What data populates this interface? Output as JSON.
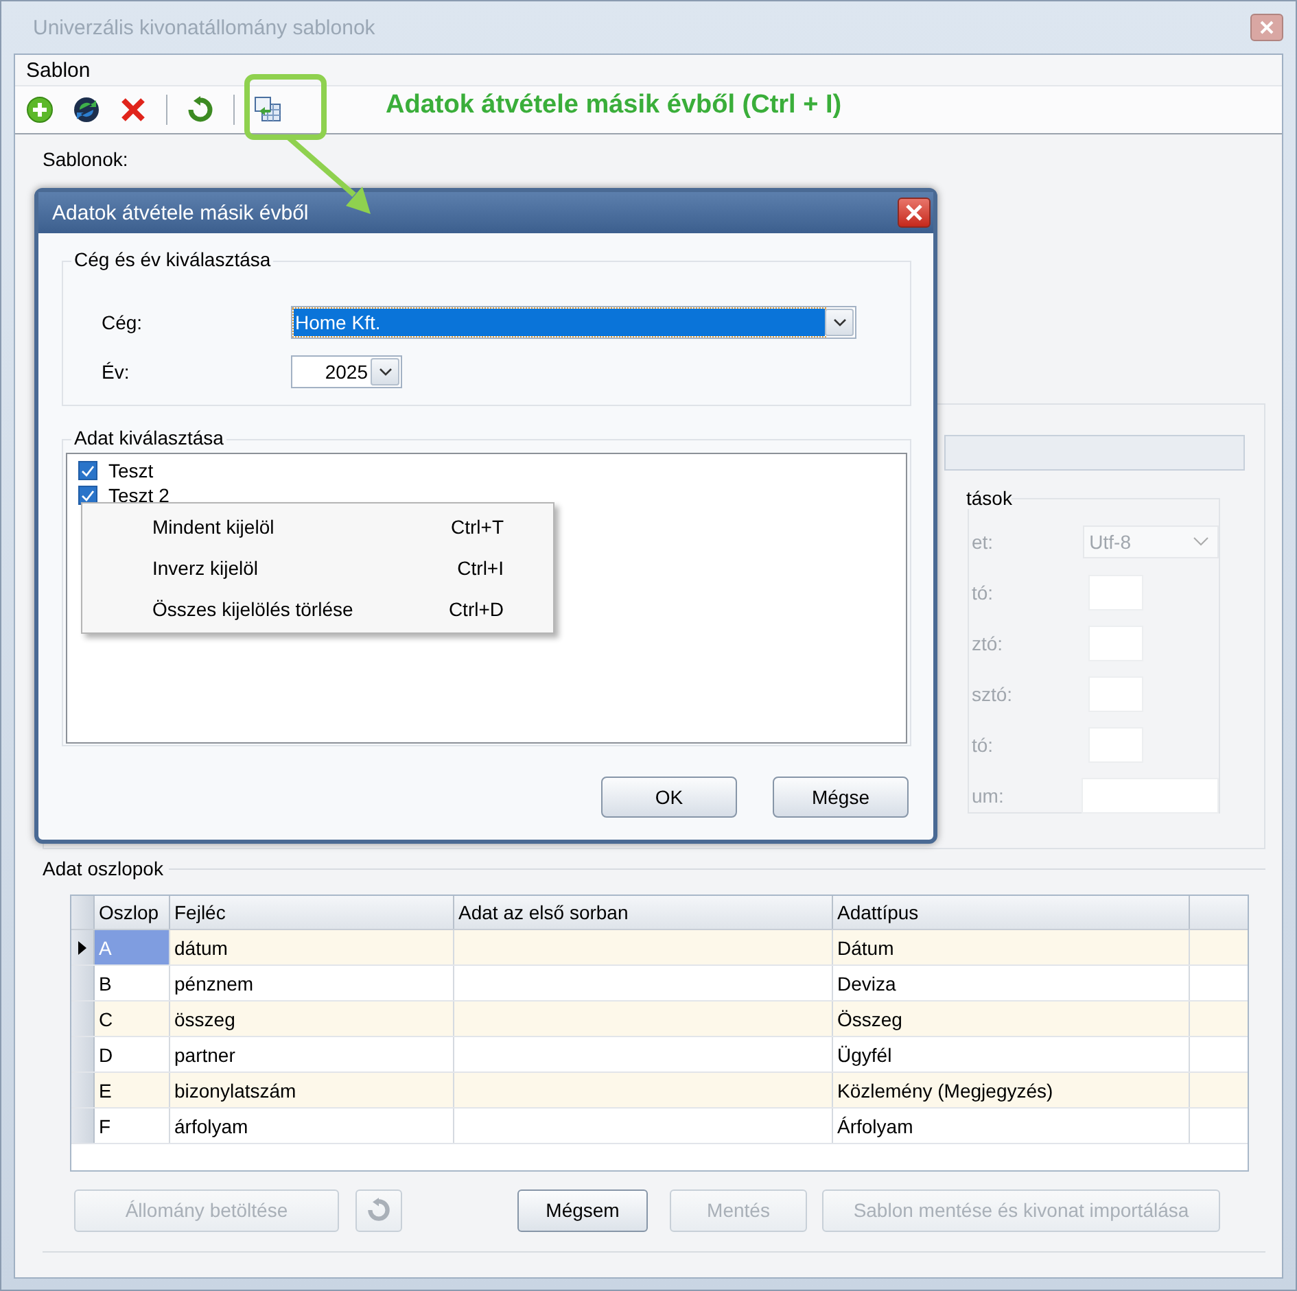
{
  "window": {
    "title": "Univerzális kivonatállomány sablonok",
    "active": false
  },
  "menu": [
    {
      "label": "Sablon"
    }
  ],
  "toolbar": [
    {
      "kind": "add"
    },
    {
      "kind": "sync"
    },
    {
      "kind": "delete"
    },
    {
      "kind": "separator"
    },
    {
      "kind": "refresh"
    },
    {
      "kind": "separator"
    },
    {
      "kind": "import"
    }
  ],
  "annotation": {
    "text": "Adatok átvétele másik évből (Ctrl + I)"
  },
  "templates_label": "Sablonok:",
  "settings_panel": {
    "group_title": "tások",
    "rows": [
      {
        "label": "et:",
        "kind": "select",
        "value": "Utf-8"
      },
      {
        "label": "tó:",
        "kind": "small"
      },
      {
        "label": "ztó:",
        "kind": "small"
      },
      {
        "label": "sztó:",
        "kind": "small"
      },
      {
        "label": "tó:",
        "kind": "small"
      },
      {
        "label": "um:",
        "kind": "wide"
      }
    ]
  },
  "columns_group": {
    "title": "Adat oszlopok",
    "columns": [
      "Oszlop",
      "Fejléc",
      "Adat az első sorban",
      "Adattípus"
    ],
    "rows": [
      {
        "column": "A",
        "header": "dátum",
        "type": "Dátum",
        "selected": true
      },
      {
        "column": "B",
        "header": "pénznem",
        "type": "Deviza",
        "selected": false
      },
      {
        "column": "C",
        "header": "összeg",
        "type": "Összeg",
        "selected": false
      },
      {
        "column": "D",
        "header": "partner",
        "type": "Ügyfél",
        "selected": false
      },
      {
        "column": "E",
        "header": "bizonylatszám",
        "type": "Közlemény (Megjegyzés)",
        "selected": false
      },
      {
        "column": "F",
        "header": "árfolyam",
        "type": "Árfolyam",
        "selected": false
      }
    ]
  },
  "buttons": [
    {
      "kind": "text",
      "label": "Állomány betöltése",
      "disabled": true
    },
    {
      "kind": "icon",
      "disabled": true
    },
    {
      "kind": "text",
      "label": "Mégsem",
      "disabled": false
    },
    {
      "kind": "text",
      "label": "Mentés",
      "disabled": true
    },
    {
      "kind": "text",
      "label": "Sablon mentése és kivonat importálása",
      "disabled": true
    }
  ],
  "dialog": {
    "title": "Adatok átvétele másik évből",
    "company_group": {
      "title": "Cég és év kiválasztása",
      "company_label": "Cég:",
      "company_value": "Home Kft.",
      "year_label": "Év:",
      "year_value": "2025"
    },
    "data_group": {
      "title": "Adat kiválasztása",
      "items": [
        {
          "label": "Teszt",
          "checked": true
        },
        {
          "label": "Teszt 2",
          "checked": true
        }
      ]
    },
    "buttons": [
      {
        "label": "OK"
      },
      {
        "label": "Mégse"
      }
    ]
  },
  "context_menu": [
    {
      "label": "Mindent kijelöl",
      "shortcut": "Ctrl+T"
    },
    {
      "label": "Inverz kijelöl",
      "shortcut": "Ctrl+I"
    },
    {
      "label": "Összes kijelölés törlése",
      "shortcut": "Ctrl+D"
    }
  ]
}
